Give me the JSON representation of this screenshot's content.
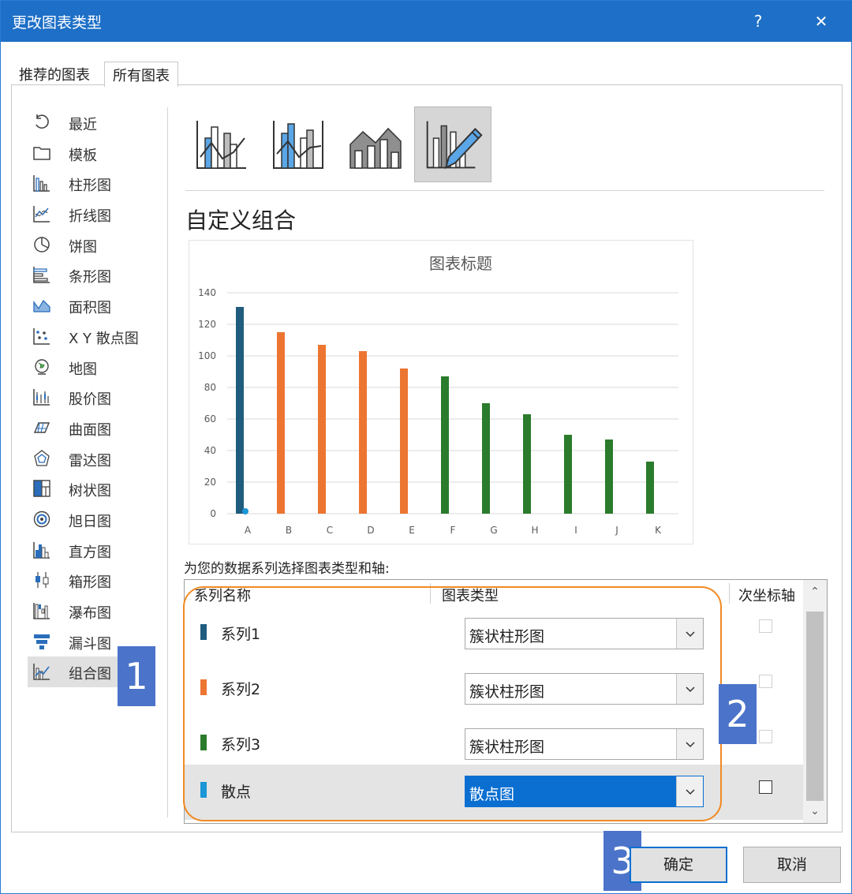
{
  "window": {
    "title": "更改图表类型",
    "help_label": "?",
    "close_label": "✕"
  },
  "tabs": [
    {
      "label": "推荐的图表",
      "active": false
    },
    {
      "label": "所有图表",
      "active": true
    }
  ],
  "sidebar": {
    "items": [
      {
        "label": "最近",
        "icon": "recent-icon"
      },
      {
        "label": "模板",
        "icon": "template-folder-icon"
      },
      {
        "label": "柱形图",
        "icon": "column-chart-icon"
      },
      {
        "label": "折线图",
        "icon": "line-chart-icon"
      },
      {
        "label": "饼图",
        "icon": "pie-chart-icon"
      },
      {
        "label": "条形图",
        "icon": "bar-chart-icon"
      },
      {
        "label": "面积图",
        "icon": "area-chart-icon"
      },
      {
        "label": "X Y 散点图",
        "icon": "scatter-chart-icon"
      },
      {
        "label": "地图",
        "icon": "map-chart-icon"
      },
      {
        "label": "股价图",
        "icon": "stock-chart-icon"
      },
      {
        "label": "曲面图",
        "icon": "surface-chart-icon"
      },
      {
        "label": "雷达图",
        "icon": "radar-chart-icon"
      },
      {
        "label": "树状图",
        "icon": "treemap-chart-icon"
      },
      {
        "label": "旭日图",
        "icon": "sunburst-chart-icon"
      },
      {
        "label": "直方图",
        "icon": "histogram-chart-icon"
      },
      {
        "label": "箱形图",
        "icon": "box-whisker-chart-icon"
      },
      {
        "label": "瀑布图",
        "icon": "waterfall-chart-icon"
      },
      {
        "label": "漏斗图",
        "icon": "funnel-chart-icon"
      },
      {
        "label": "组合图",
        "icon": "combo-chart-icon",
        "selected": true
      }
    ]
  },
  "combo_subtypes": [
    {
      "icon": "clustered-column-line-icon"
    },
    {
      "icon": "clustered-column-line-secondary-axis-icon"
    },
    {
      "icon": "stacked-area-clustered-column-icon"
    },
    {
      "icon": "custom-combination-icon",
      "selected": true
    }
  ],
  "section_title": "自定义组合",
  "chart_data": {
    "type": "bar",
    "title": "图表标题",
    "categories": [
      "A",
      "B",
      "C",
      "D",
      "E",
      "F",
      "G",
      "H",
      "I",
      "J",
      "K"
    ],
    "ylim": [
      0,
      140
    ],
    "yticks": [
      0,
      20,
      40,
      60,
      80,
      100,
      120,
      140
    ],
    "grid": true,
    "series": [
      {
        "color": "#1f5c7e",
        "values": [
          131,
          null,
          null,
          null,
          null,
          null,
          null,
          null,
          null,
          null,
          null
        ]
      },
      {
        "color": "#ed7532",
        "values": [
          null,
          115,
          107,
          103,
          92,
          null,
          null,
          null,
          null,
          null,
          null
        ]
      },
      {
        "color": "#2a7b2c",
        "values": [
          null,
          null,
          null,
          null,
          null,
          87,
          70,
          63,
          50,
          47,
          33
        ]
      }
    ],
    "scatter": {
      "color": "#1b96d6",
      "points": [
        {
          "x": "A",
          "y": 1
        }
      ]
    }
  },
  "prompt": "为您的数据系列选择图表类型和轴:",
  "table": {
    "headers": {
      "name": "系列名称",
      "type": "图表类型",
      "secondary": "次坐标轴"
    },
    "rows": [
      {
        "name": "系列1",
        "color": "#1f5c7e",
        "type": "簇状柱形图",
        "secondary_checked": false,
        "highlight": false
      },
      {
        "name": "系列2",
        "color": "#ed7532",
        "type": "簇状柱形图",
        "secondary_checked": false,
        "highlight": false
      },
      {
        "name": "系列3",
        "color": "#2a7b2c",
        "type": "簇状柱形图",
        "secondary_checked": false,
        "highlight": false
      },
      {
        "name": "散点",
        "color": "#1b96d6",
        "type": "散点图",
        "secondary_checked": false,
        "highlight": true
      }
    ]
  },
  "annotations": {
    "badge1": "1",
    "badge2": "2",
    "badge3": "3"
  },
  "buttons": {
    "ok": "确定",
    "cancel": "取消"
  },
  "scroll": {
    "up": "⌃",
    "down": "⌄"
  }
}
